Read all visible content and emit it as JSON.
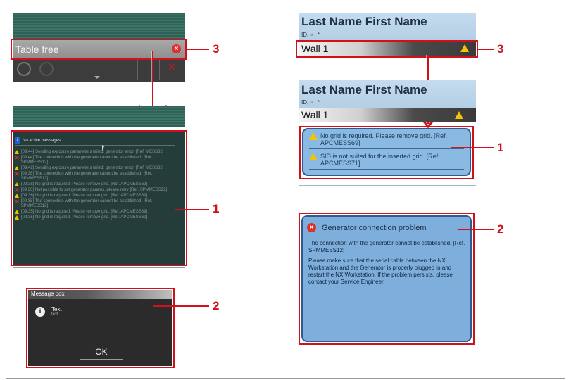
{
  "left": {
    "table_free_label": "Table free",
    "no_active_messages": "No active messages",
    "messages": [
      {
        "type": "warn",
        "text": "[09:44] Sending exposure parameters failed: generator error. [Ref. MESS32]"
      },
      {
        "type": "err",
        "text": "[09:44] The connection with the generator cannot be established. [Ref. SPMMESS12]"
      },
      {
        "type": "warn",
        "text": "[09:42] Sending exposure parameters failed: generator error. [Ref. MESS32]"
      },
      {
        "type": "err",
        "text": "[09:38] The connection with the generator cannot be established. [Ref. SPMMESS12]"
      },
      {
        "type": "warn",
        "text": "[09:38] No grid is required. Please remove grid. [Ref. APCMESS69]"
      },
      {
        "type": "err",
        "text": "[09:36] Not possible to set generator params, please retry [Ref. SPMMESS22]"
      },
      {
        "type": "warn",
        "text": "[09:36] No grid is required. Please remove grid. [Ref. APCMESS69]"
      },
      {
        "type": "err",
        "text": "[09:35] The connection with the generator cannot be established. [Ref. SPMMESS12]"
      },
      {
        "type": "warn",
        "text": "[09:35] No grid is required. Please remove grid. [Ref. APCMESS69]"
      },
      {
        "type": "warn",
        "text": "[09:35] No grid is required. Please remove grid. [Ref. APCMESS69]"
      }
    ],
    "msgbox_title": "Message box",
    "msgbox_text": "Text",
    "msgbox_subtext": "text",
    "ok_label": "OK"
  },
  "right": {
    "patient_name": "Last Name First Name",
    "patient_id_top": "ID, ♂, *",
    "patient_id_bottom": "ID, ♂, *",
    "wall_label": "Wall 1",
    "warnings": [
      "No grid is required. Please remove grid. [Ref. APCMESS69]",
      "SID is not suited for the inserted grid. [Ref. APCMESS71]"
    ],
    "popup_title": "Generator connection problem",
    "popup_para1": "The connection with the generator cannot be established. [Ref. SPMMESS12]",
    "popup_para2": "Please make sure that the serial cable between the NX Workstation and the Generator is properly plugged in and restart the NX Workstation. If the problem persists, please contact your Service Engineer."
  },
  "callouts": [
    "3",
    "1",
    "2",
    "3",
    "1",
    "2"
  ],
  "colors": {
    "callout": "#d0101a",
    "dark_panel": "#2a4a47",
    "blue_panel": "#7eaedb"
  }
}
